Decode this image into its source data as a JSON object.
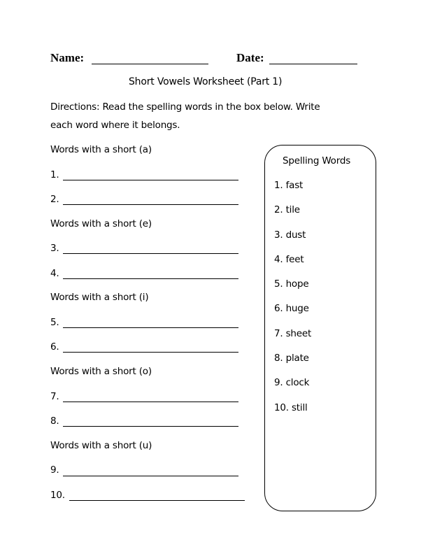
{
  "header": {
    "name_label": "Name:",
    "date_label": "Date:"
  },
  "title": "Short Vowels Worksheet (Part 1)",
  "directions": {
    "line1": "Directions: Read the spelling words in the box below. Write",
    "line2": "each word where it belongs."
  },
  "sections": [
    {
      "heading": "Words with a short (a)",
      "items": [
        "1.",
        "2."
      ]
    },
    {
      "heading": "Words with a short (e)",
      "items": [
        "3.",
        "4."
      ]
    },
    {
      "heading": "Words with a short (i)",
      "items": [
        "5.",
        "6."
      ]
    },
    {
      "heading": "Words with a short (o)",
      "items": [
        "7.",
        "8."
      ]
    },
    {
      "heading": "Words with a short (u)",
      "items": [
        "9.",
        "10."
      ]
    }
  ],
  "word_box": {
    "title": "Spelling Words",
    "words": [
      "1. fast",
      "2. tile",
      "3. dust",
      "4. feet",
      "5. hope",
      "6. huge",
      "7. sheet",
      "8. plate",
      "9. clock",
      "10. still"
    ]
  }
}
